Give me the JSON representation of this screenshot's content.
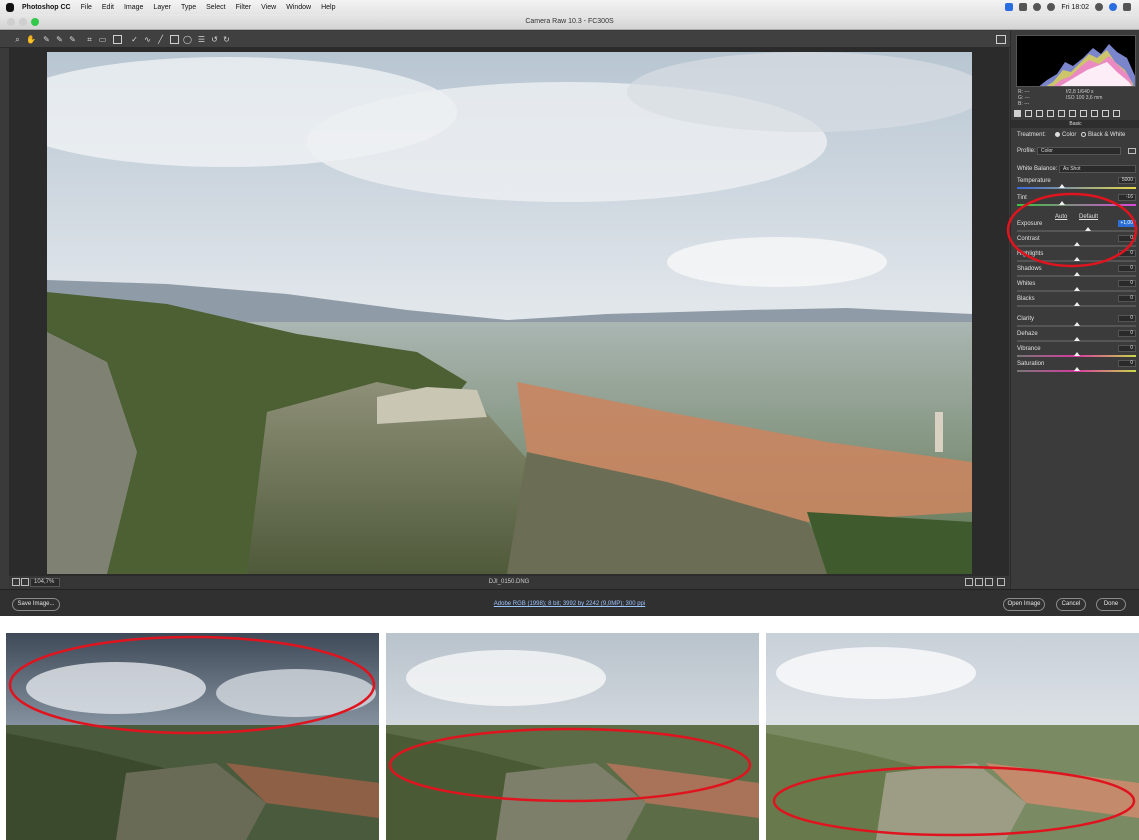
{
  "menubar": {
    "app_name": "Photoshop CC",
    "menus": [
      "File",
      "Edit",
      "Image",
      "Layer",
      "Type",
      "Select",
      "Filter",
      "View",
      "Window",
      "Help"
    ],
    "clock": "Fri 18:02"
  },
  "window": {
    "title": "Camera Raw 10.3  -  FC300S"
  },
  "bottom": {
    "zoom": "104,7%",
    "filename": "DJI_0150.DNG",
    "workflow_link": "Adobe RGB (1998); 8 bit; 3992 by 2242 (9,0MP); 300 ppi",
    "save_label": "Save Image...",
    "open_label": "Open Image",
    "cancel_label": "Cancel",
    "done_label": "Done"
  },
  "panel": {
    "rgb": {
      "r": "R:  ---",
      "g": "G:  ---",
      "b": "B:  ---"
    },
    "camera_line1": "f/2,8   1/640 s",
    "camera_line2": "ISO 100   3,6 mm",
    "section_title": "Basic",
    "treatment_label": "Treatment:",
    "treatment_color": "Color",
    "treatment_bw": "Black & White",
    "profile_label": "Profile:",
    "profile_value": "Color",
    "wb_label": "White Balance:",
    "wb_value": "As Shot",
    "auto_label": "Auto",
    "default_label": "Default",
    "sliders": [
      {
        "label": "Temperature",
        "value": "5000",
        "pos": 0.38
      },
      {
        "label": "Tint",
        "value": "-16",
        "pos": 0.38
      },
      {
        "label": "Exposure",
        "value": "+1,00",
        "pos": 0.6
      },
      {
        "label": "Contrast",
        "value": "0",
        "pos": 0.5
      },
      {
        "label": "Highlights",
        "value": "0",
        "pos": 0.5
      },
      {
        "label": "Shadows",
        "value": "0",
        "pos": 0.5
      },
      {
        "label": "Whites",
        "value": "0",
        "pos": 0.5
      },
      {
        "label": "Blacks",
        "value": "0",
        "pos": 0.5
      },
      {
        "label": "Clarity",
        "value": "0",
        "pos": 0.5
      },
      {
        "label": "Dehaze",
        "value": "0",
        "pos": 0.5
      },
      {
        "label": "Vibrance",
        "value": "0",
        "pos": 0.5
      },
      {
        "label": "Saturation",
        "value": "0",
        "pos": 0.5
      }
    ]
  },
  "colors": {
    "highlight_ellipse": "#e0141e",
    "selected_field": "#2b6fd6"
  }
}
